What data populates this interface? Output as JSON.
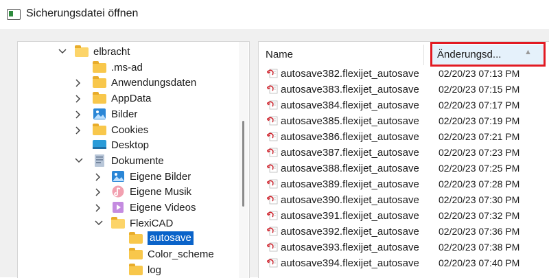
{
  "window": {
    "title": "Sicherungsdatei öffnen"
  },
  "tree": {
    "items": [
      {
        "label": "elbracht",
        "icon": "folder-icon",
        "expander": "expanded"
      },
      {
        "label": ".ms-ad",
        "icon": "folder-icon",
        "expander": "none"
      },
      {
        "label": "Anwendungsdaten",
        "icon": "folder-icon",
        "expander": "collapsed"
      },
      {
        "label": "AppData",
        "icon": "folder-icon",
        "expander": "collapsed"
      },
      {
        "label": "Bilder",
        "icon": "pictures-icon",
        "expander": "collapsed"
      },
      {
        "label": "Cookies",
        "icon": "folder-icon",
        "expander": "collapsed"
      },
      {
        "label": "Desktop",
        "icon": "desktop-icon",
        "expander": "none"
      },
      {
        "label": "Dokumente",
        "icon": "documents-icon",
        "expander": "expanded"
      },
      {
        "label": "Eigene Bilder",
        "icon": "pictures-icon",
        "expander": "collapsed"
      },
      {
        "label": "Eigene Musik",
        "icon": "music-icon",
        "expander": "collapsed"
      },
      {
        "label": "Eigene Videos",
        "icon": "videos-icon",
        "expander": "collapsed"
      },
      {
        "label": "FlexiCAD",
        "icon": "folder-icon",
        "expander": "expanded"
      },
      {
        "label": "autosave",
        "icon": "folder-icon",
        "expander": "none",
        "selected": true
      },
      {
        "label": "Color_scheme",
        "icon": "folder-icon",
        "expander": "none"
      },
      {
        "label": "log",
        "icon": "folder-icon",
        "expander": "none"
      }
    ]
  },
  "list": {
    "columns": {
      "name": "Name",
      "date": "Änderungsd..."
    },
    "rows": [
      {
        "name": "autosave382.flexijet_autosave",
        "date": "02/20/23 07:13 PM"
      },
      {
        "name": "autosave383.flexijet_autosave",
        "date": "02/20/23 07:15 PM"
      },
      {
        "name": "autosave384.flexijet_autosave",
        "date": "02/20/23 07:17 PM"
      },
      {
        "name": "autosave385.flexijet_autosave",
        "date": "02/20/23 07:19 PM"
      },
      {
        "name": "autosave386.flexijet_autosave",
        "date": "02/20/23 07:21 PM"
      },
      {
        "name": "autosave387.flexijet_autosave",
        "date": "02/20/23 07:23 PM"
      },
      {
        "name": "autosave388.flexijet_autosave",
        "date": "02/20/23 07:25 PM"
      },
      {
        "name": "autosave389.flexijet_autosave",
        "date": "02/20/23 07:28 PM"
      },
      {
        "name": "autosave390.flexijet_autosave",
        "date": "02/20/23 07:30 PM"
      },
      {
        "name": "autosave391.flexijet_autosave",
        "date": "02/20/23 07:32 PM"
      },
      {
        "name": "autosave392.flexijet_autosave",
        "date": "02/20/23 07:36 PM"
      },
      {
        "name": "autosave393.flexijet_autosave",
        "date": "02/20/23 07:38 PM"
      },
      {
        "name": "autosave394.flexijet_autosave",
        "date": "02/20/23 07:40 PM"
      }
    ]
  },
  "colors": {
    "selection": "#0a63c9",
    "highlight_box": "#e21a23",
    "folder": "#f8c74b"
  }
}
